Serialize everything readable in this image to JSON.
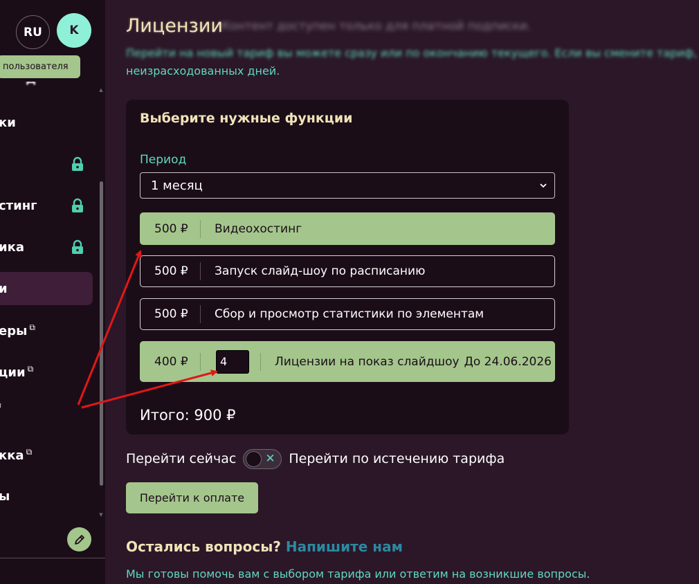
{
  "header": {
    "language": "RU",
    "avatar_initial": "K",
    "tooltip": "пользователя"
  },
  "sidebar": {
    "items": [
      {
        "label": "ки",
        "locked": false,
        "external": false,
        "active": false
      },
      {
        "label": "",
        "locked": true,
        "external": false,
        "active": false
      },
      {
        "label": "стинг",
        "locked": true,
        "external": false,
        "active": false
      },
      {
        "label": "ика",
        "locked": true,
        "external": false,
        "active": false
      },
      {
        "label": "и",
        "locked": false,
        "external": false,
        "active": true
      },
      {
        "label": "еры",
        "locked": false,
        "external": true,
        "active": false
      },
      {
        "label": "ции",
        "locked": false,
        "external": true,
        "active": false
      },
      {
        "label": "",
        "locked": false,
        "external": true,
        "active": false
      },
      {
        "label": "кка",
        "locked": false,
        "external": true,
        "active": false
      },
      {
        "label": "ы",
        "locked": false,
        "external": false,
        "active": false
      }
    ]
  },
  "page": {
    "title": "Лицензии",
    "blurred_subtitle": "Контент доступен только для платной подписки.",
    "notice_line1": "Перейти на новый тариф вы можете сразу или по окончанию текущего. Если вы смените тариф,",
    "notice_line2": "неизрасходованных дней."
  },
  "card": {
    "title": "Выберите нужные функции",
    "period_label": "Период",
    "period_value": "1 месяц",
    "options": [
      {
        "price": "500 ₽",
        "name": "Видеохостинг",
        "selected": true
      },
      {
        "price": "500 ₽",
        "name": "Запуск слайд-шоу по расписанию",
        "selected": false
      },
      {
        "price": "500 ₽",
        "name": "Сбор и просмотр статистики по элементам",
        "selected": false
      }
    ],
    "license_option": {
      "price": "400 ₽",
      "quantity": "4",
      "name": "Лицензии на показ слайдшоу",
      "date": "До 24.06.2026",
      "selected": true
    },
    "total": "Итого: 900 ₽"
  },
  "switch": {
    "left_label": "Перейти сейчас",
    "right_label": "Перейти по истечению тарифа"
  },
  "pay_button": "Перейти к оплате",
  "questions": {
    "text": "Остались вопросы?",
    "link": "Напишите нам",
    "help_text": "Мы готовы помочь вам с выбором тарифа или ответим на возникшие вопросы."
  },
  "colors": {
    "background": "#2b1728",
    "sidebar": "#1b0d18",
    "accent_green": "#a4c68c",
    "accent_teal": "#5fd9c0",
    "title_cream": "#f1e3b8",
    "annotation_red": "#e01818"
  }
}
